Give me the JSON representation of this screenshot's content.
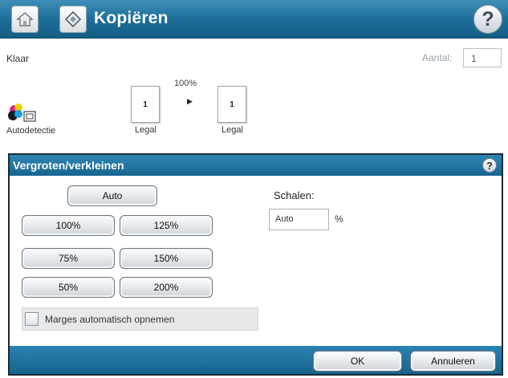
{
  "topbar": {
    "home_icon": "home-icon",
    "app_icon": "copy-diamond-icon",
    "title": "Kopiëren",
    "help_glyph": "?"
  },
  "status": {
    "text": "Klaar",
    "count_label": "Aantal:",
    "count_value": "1",
    "zoom_percent": "100%",
    "source_page_count": "1",
    "dest_page_count": "1",
    "source_size": "Legal",
    "dest_size": "Legal",
    "color_mode_label": "Autodetectie",
    "color_mode_icon": "color-drops-icon"
  },
  "dialog": {
    "title": "Vergroten/verkleinen",
    "help_glyph": "?",
    "buttons": {
      "auto": "Auto",
      "p100": "100%",
      "p125": "125%",
      "p75": "75%",
      "p150": "150%",
      "p50": "50%",
      "p200": "200%"
    },
    "scale_label": "Schalen:",
    "scale_value": "Auto",
    "scale_unit": "%",
    "checkbox_label": "Marges automatisch opnemen",
    "checkbox_checked": false,
    "ok_label": "OK",
    "cancel_label": "Annuleren"
  },
  "colors": {
    "title_bar": "#1d6f9a",
    "dialog_border": "#1c2a36",
    "button_face": "#e9ecef"
  }
}
